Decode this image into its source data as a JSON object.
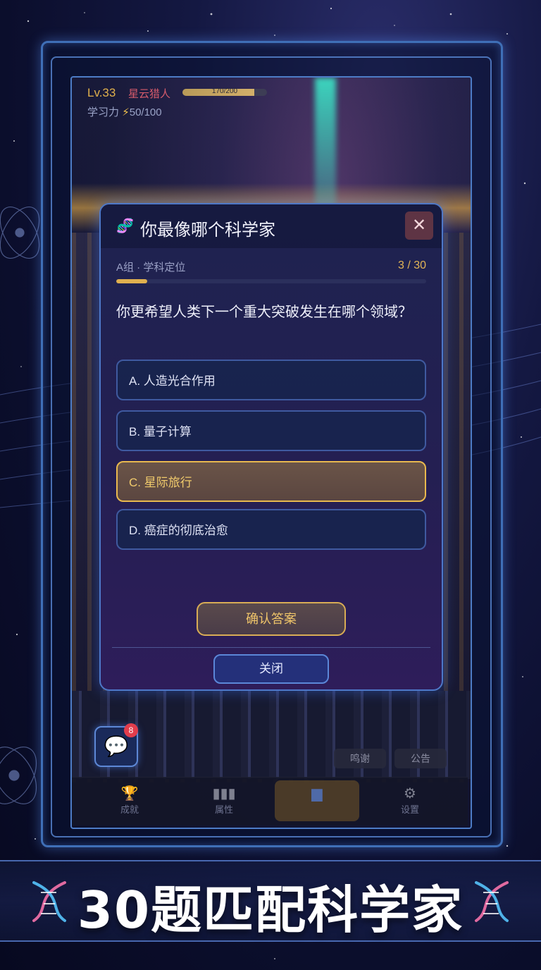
{
  "player": {
    "level": "Lv.33",
    "name": "星云猎人",
    "xp_text": "170/200",
    "xp_fraction": 0.85,
    "study_label": "学习力",
    "study_icon": "lightning-icon",
    "study_value": "50/100"
  },
  "quiz": {
    "title": "你最像哪个科学家",
    "group": "A组 · 学科定位",
    "progress_text": "3 / 30",
    "progress_fraction": 0.1,
    "question": "你更希望人类下一个重大突破发生在哪个领域？",
    "options": [
      {
        "label": "A. 人造光合作用",
        "selected": false
      },
      {
        "label": "B. 量子计算",
        "selected": false
      },
      {
        "label": "C. 星际旅行",
        "selected": true
      },
      {
        "label": "D. 癌症的彻底治愈",
        "selected": false
      }
    ],
    "confirm_label": "确认答案",
    "close_label": "关闭"
  },
  "chat": {
    "badge_count": "8"
  },
  "chips": [
    "鸣谢",
    "公告"
  ],
  "nav": [
    {
      "label": "成就",
      "icon": "trophy-icon",
      "active": false
    },
    {
      "label": "属性",
      "icon": "bar-chart-icon",
      "active": false
    },
    {
      "label": "",
      "icon": "book-icon",
      "active": true
    },
    {
      "label": "设置",
      "icon": "gear-icon",
      "active": false
    }
  ],
  "banner": {
    "text": "30题匹配科学家"
  },
  "colors": {
    "accent_gold": "#e0b04f",
    "frame_blue": "#4e78c8",
    "badge_red": "#e23d4c"
  }
}
